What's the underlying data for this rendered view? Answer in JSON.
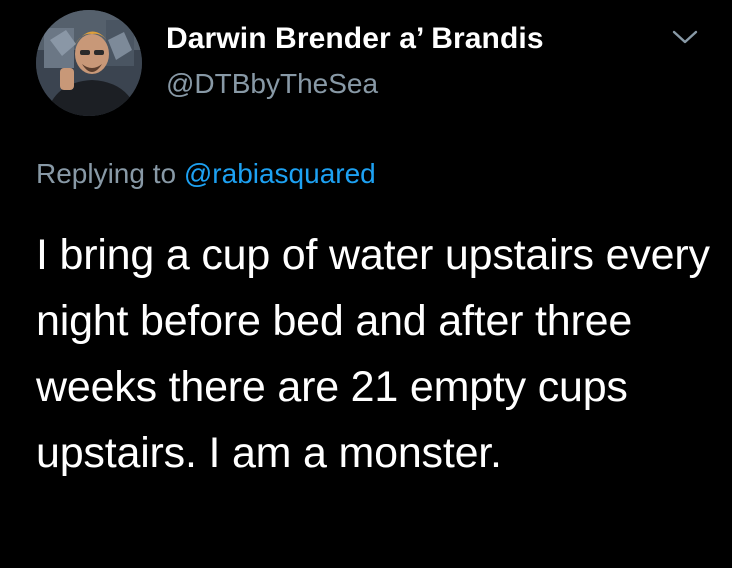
{
  "author": {
    "display_name": "Darwin Brender a’ Brandis",
    "handle": "@DTBbyTheSea"
  },
  "reply": {
    "prefix": "Replying to ",
    "mention": "@rabiasquared"
  },
  "tweet": {
    "text": "I bring a cup of water upstairs every night before bed and after three weeks there are 21 empty cups upstairs. I am a monster."
  },
  "icons": {
    "menu": "chevron-down-icon"
  },
  "colors": {
    "background": "#000000",
    "primary_text": "#ffffff",
    "secondary_text": "#8899a6",
    "link": "#1da1f2"
  }
}
